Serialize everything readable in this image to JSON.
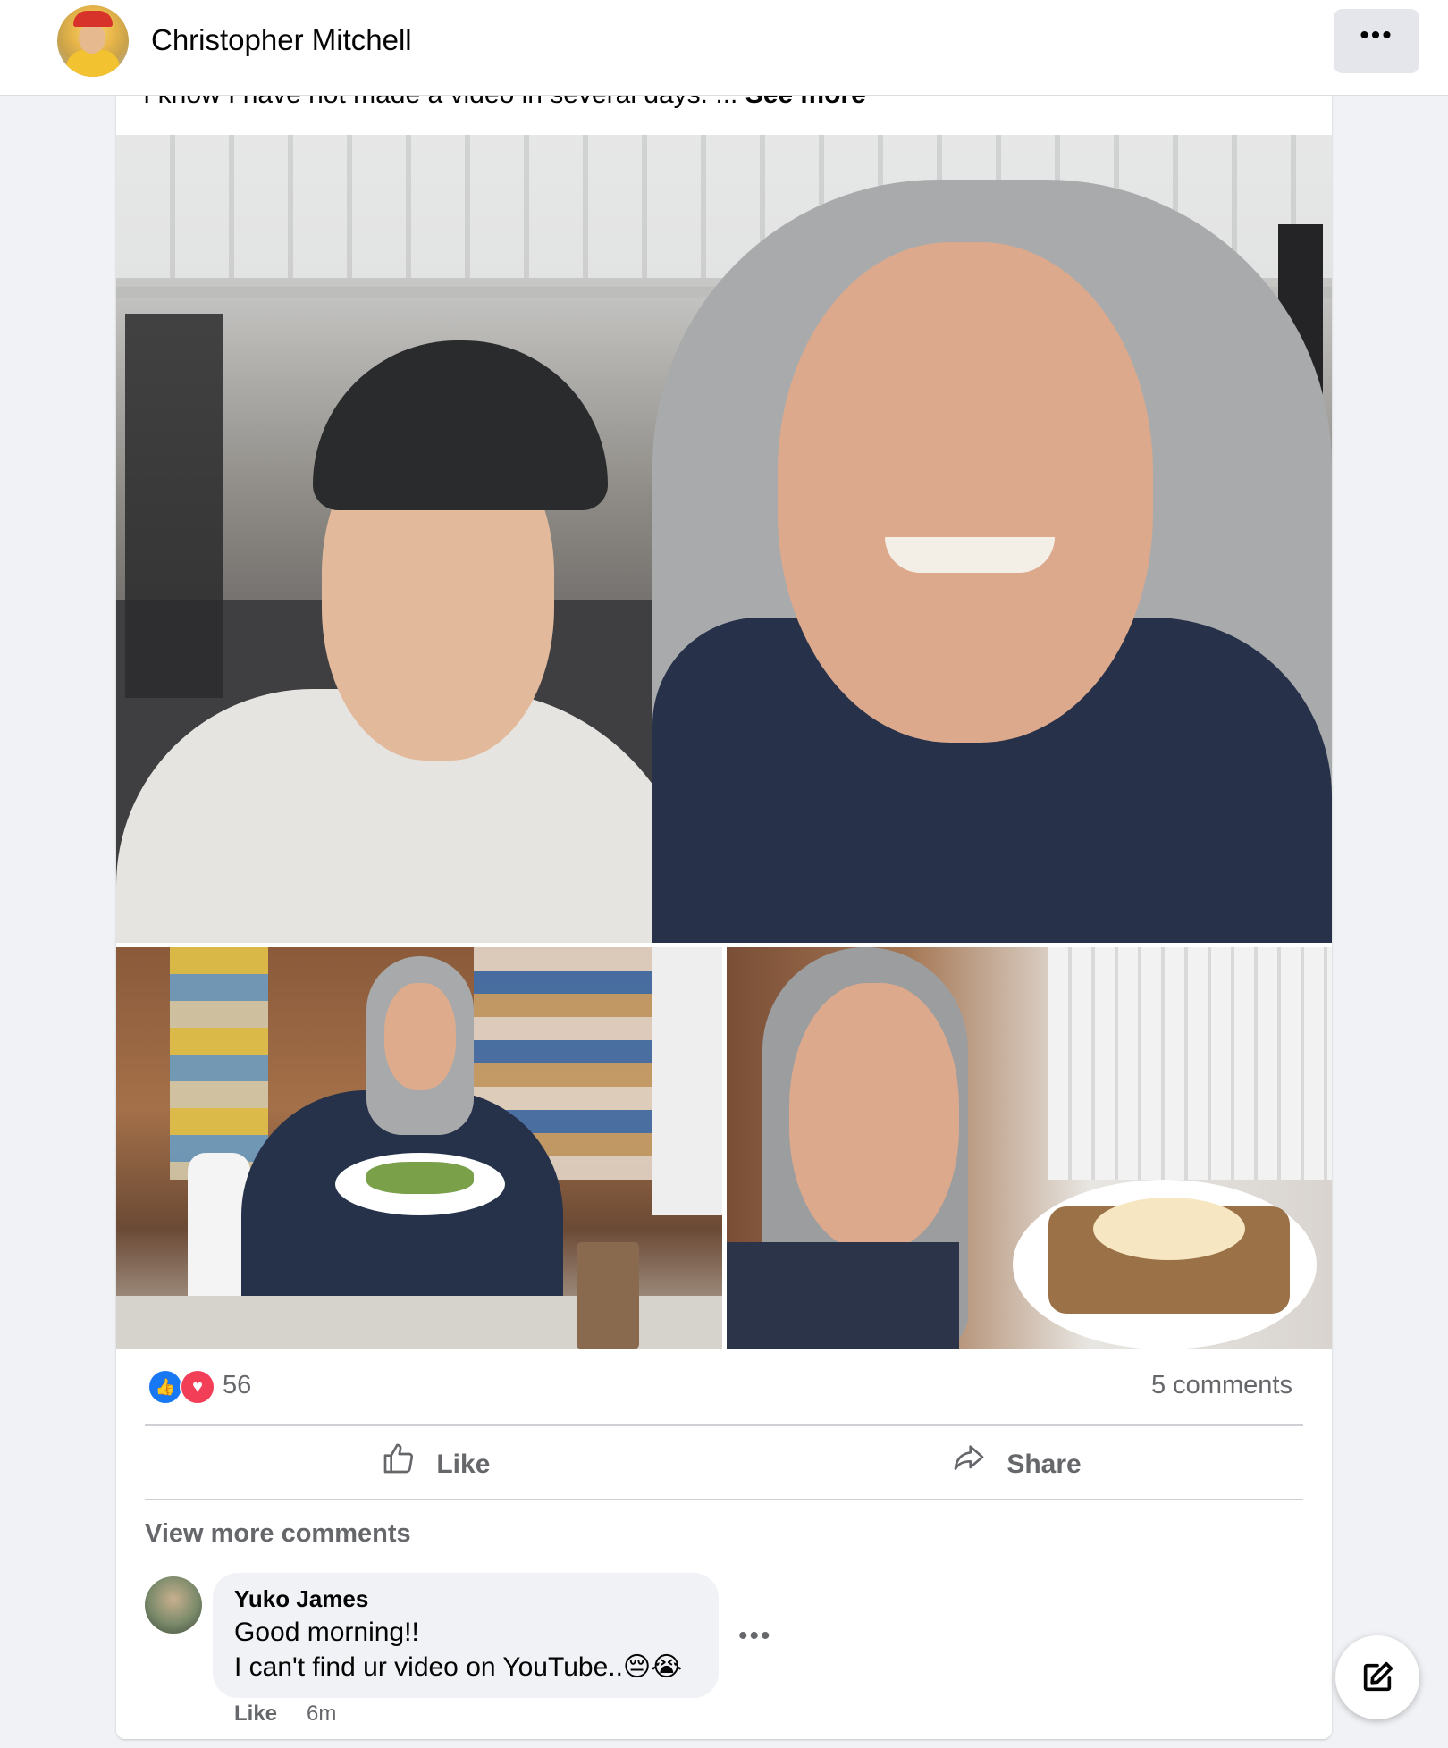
{
  "header": {
    "author": "Christopher Mitchell",
    "menu_label": "•••"
  },
  "post": {
    "caption": "I know I have not made a video in several days. ...",
    "see_more": "See more",
    "photos": [
      {
        "alt_name": "gym-selfie-photo"
      },
      {
        "alt_name": "cafe-plate-photo"
      },
      {
        "alt_name": "avocado-toast-selfie-photo"
      }
    ],
    "reactions": {
      "like_glyph": "👍",
      "love_glyph": "♥",
      "count": "56"
    },
    "comments_count": "5 comments",
    "actions": {
      "like": "Like",
      "share": "Share"
    }
  },
  "comments": {
    "view_more": "View more comments",
    "items": [
      {
        "author": "Yuko James",
        "line1": "Good morning!!",
        "line2": "I can't find ur video on YouTube..😔😭",
        "more": "•••",
        "like": "Like",
        "time": "6m"
      }
    ]
  },
  "icons": {
    "like": "thumbs-up-icon",
    "share": "share-arrow-icon",
    "compose": "compose-edit-icon"
  },
  "colors": {
    "like_blue": "#1877f2",
    "love_red": "#f33e58",
    "muted_text": "#65676b"
  }
}
